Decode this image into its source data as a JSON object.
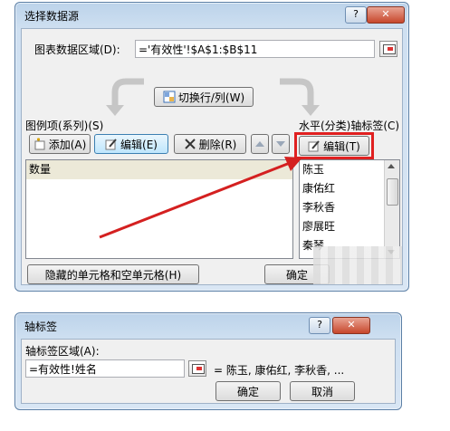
{
  "dialog1": {
    "title": "选择数据源",
    "help_glyph": "?",
    "close_glyph": "✕",
    "range_label": "图表数据区域(D):",
    "range_value": "='有效性'!$A$1:$B$11",
    "switch_button": "切换行/列(W)",
    "series_header": "图例项(系列)(S)",
    "axis_header": "水平(分类)轴标签(C)",
    "add_button": "添加(A)",
    "edit_button": "编辑(E)",
    "delete_button": "删除(R)",
    "axis_edit_button": "编辑(T)",
    "series_items": [
      "数量"
    ],
    "axis_items": [
      "陈玉",
      "康佑红",
      "李秋香",
      "廖展旺",
      "秦琴"
    ],
    "hidden_cells_button": "隐藏的单元格和空单元格(H)",
    "ok_button": "确定"
  },
  "dialog2": {
    "title": "轴标签",
    "help_glyph": "?",
    "close_glyph": "✕",
    "range_label": "轴标签区域(A):",
    "range_value": "=有效性!姓名",
    "preview": "= 陈玉, 康佑红, 李秋香, ...",
    "ok_button": "确定",
    "cancel_button": "取消"
  },
  "colors": {
    "highlight_box": "#e02020",
    "arrow": "#d42020"
  }
}
